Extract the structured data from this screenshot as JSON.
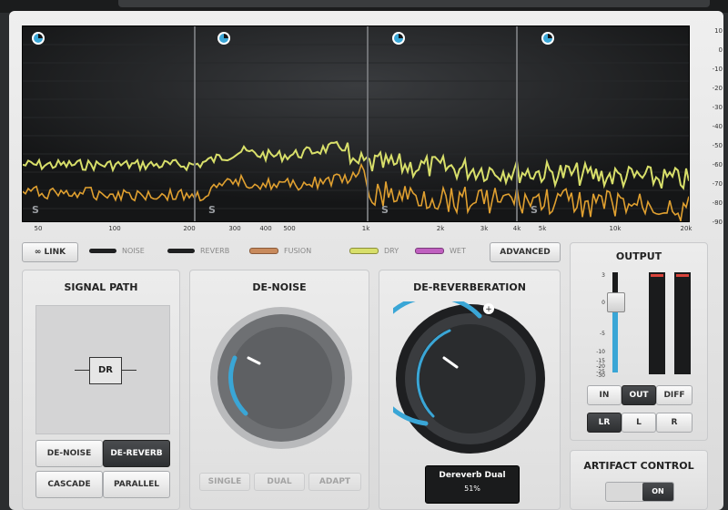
{
  "analyzer": {
    "y_labels": [
      "10",
      "0",
      "-10",
      "-20",
      "-30",
      "-40",
      "-50",
      "-60",
      "-70",
      "-80",
      "-90"
    ],
    "x_labels": [
      "50",
      "100",
      "200",
      "300",
      "400",
      "500",
      "1k",
      "2k",
      "3k",
      "4k",
      "5k",
      "10k",
      "20k"
    ],
    "band_label": "S"
  },
  "toolbar": {
    "link_label": "LINK",
    "advanced_label": "ADVANCED"
  },
  "legend": [
    {
      "label": "NOISE",
      "color": "#1f2021"
    },
    {
      "label": "REVERB",
      "color": "#1f2021"
    },
    {
      "label": "FUSION",
      "color": "#c88a5c"
    },
    {
      "label": "DRY",
      "color": "#d8df6a"
    },
    {
      "label": "WET",
      "color": "#c060c0"
    }
  ],
  "signal_path": {
    "title": "SIGNAL PATH",
    "block_label": "DR",
    "buttons": [
      "DE-NOISE",
      "DE-REVERB",
      "CASCADE",
      "PARALLEL"
    ],
    "active": "DE-REVERB"
  },
  "de_noise": {
    "title": "DE-NOISE",
    "mode_buttons": [
      "SINGLE",
      "DUAL",
      "ADAPT"
    ],
    "amount_fraction": 0.33
  },
  "de_reverb": {
    "title": "DE-REVERBERATION",
    "tooltip_title": "Dereverb Dual",
    "tooltip_value": "51%",
    "amount_fraction": 0.51
  },
  "output": {
    "title": "OUTPUT",
    "scale": [
      "3",
      "0",
      "-5",
      "-10",
      "-15",
      "-20",
      "-25",
      "-30"
    ],
    "monitor_buttons": [
      "IN",
      "OUT",
      "DIFF"
    ],
    "monitor_active": "OUT",
    "channel_buttons": [
      "LR",
      "L",
      "R"
    ],
    "channel_active": "LR"
  },
  "artifact": {
    "title": "ARTIFACT CONTROL",
    "toggle_on_label": "ON"
  },
  "colors": {
    "accent": "#3aa6d6",
    "spectrum_dry": "#d8df6a",
    "spectrum_wet": "#e0a030"
  }
}
